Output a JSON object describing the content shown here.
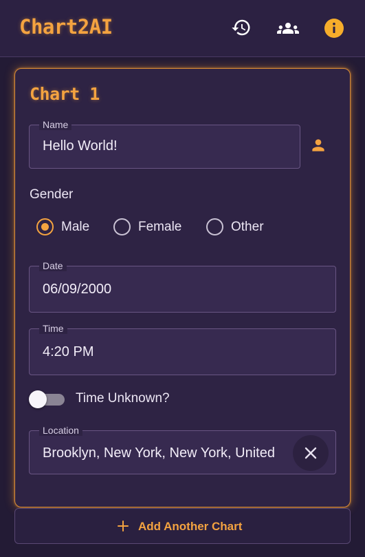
{
  "header": {
    "brand": "Chart2AI",
    "icons": [
      "history-icon",
      "group-icon",
      "info-icon"
    ]
  },
  "chart_form": {
    "title": "Chart 1",
    "name": {
      "label": "Name",
      "value": "Hello World!"
    },
    "gender": {
      "heading": "Gender",
      "options": [
        "Male",
        "Female",
        "Other"
      ],
      "selected": "Male"
    },
    "date": {
      "label": "Date",
      "value": "06/09/2000"
    },
    "time": {
      "label": "Time",
      "value": "4:20 PM"
    },
    "time_unknown": {
      "label": "Time Unknown?",
      "checked": false
    },
    "location": {
      "label": "Location",
      "value": "Brooklyn, New York, New York, United"
    }
  },
  "add_chart": {
    "label": "Add Another Chart"
  },
  "colors": {
    "accent": "#f4a340",
    "background": "#231b35",
    "card": "#2e2344",
    "field": "#372a50"
  }
}
